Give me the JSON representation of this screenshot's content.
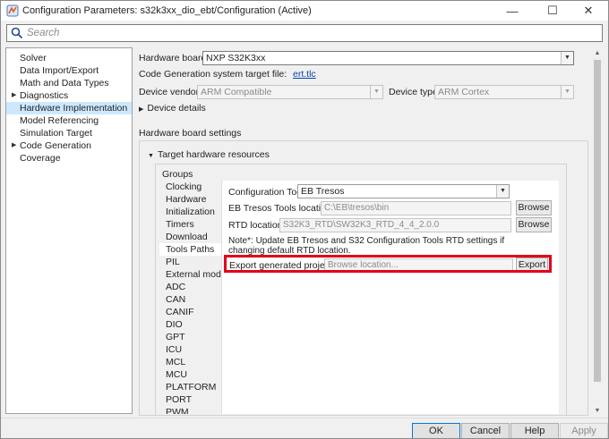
{
  "window": {
    "title": "Configuration Parameters: s32k3xx_dio_ebt/Configuration (Active)",
    "minimize_label": "—",
    "maximize_label": "☐",
    "close_label": "✕"
  },
  "search": {
    "placeholder": "Search"
  },
  "sidebar": {
    "items": [
      {
        "label": "Solver",
        "expandable": false
      },
      {
        "label": "Data Import/Export",
        "expandable": false
      },
      {
        "label": "Math and Data Types",
        "expandable": false
      },
      {
        "label": "Diagnostics",
        "expandable": true
      },
      {
        "label": "Hardware Implementation",
        "expandable": false,
        "selected": true
      },
      {
        "label": "Model Referencing",
        "expandable": false
      },
      {
        "label": "Simulation Target",
        "expandable": false
      },
      {
        "label": "Code Generation",
        "expandable": true
      },
      {
        "label": "Coverage",
        "expandable": false
      }
    ]
  },
  "main": {
    "hardware_board_label": "Hardware board:",
    "hardware_board_value": "NXP S32K3xx",
    "target_file_label": "Code Generation system target file:",
    "target_file_link": "ert.tlc",
    "device_vendor_label": "Device vendor:",
    "device_vendor_value": "ARM Compatible",
    "device_type_label": "Device type:",
    "device_type_value": "ARM Cortex",
    "device_details_label": "Device details",
    "board_settings_label": "Hardware board settings",
    "target_resources_label": "Target hardware resources",
    "groups_label": "Groups"
  },
  "groups": {
    "items": [
      "Clocking",
      "Hardware",
      "Initialization",
      "Timers",
      "Download",
      "Tools Paths",
      "PIL",
      "External mode",
      "ADC",
      "CAN",
      "CANIF",
      "DIO",
      "GPT",
      "ICU",
      "MCL",
      "MCU",
      "PLATFORM",
      "PORT",
      "PWM"
    ],
    "active": "Tools Paths"
  },
  "tools_paths": {
    "config_tool_label": "Configuration Tool:",
    "config_tool_value": "EB Tresos",
    "eb_location_label": "EB Tresos Tools location:",
    "eb_location_value": "C:\\EB\\tresos\\bin",
    "rtd_location_label": "RTD location:",
    "rtd_location_value": "S32K3_RTD\\SW32K3_RTD_4_4_2.0.0",
    "browse_label": "Browse",
    "note_line1": "Note*: Update EB Tresos and S32 Configuration Tools RTD settings if",
    "note_line2": "changing default RTD location.",
    "export_label": "Export generated projects:",
    "export_placeholder": "Browse location...",
    "export_button": "Export"
  },
  "footer": {
    "ok_label": "OK",
    "cancel_label": "Cancel",
    "help_label": "Help",
    "apply_label": "Apply"
  }
}
